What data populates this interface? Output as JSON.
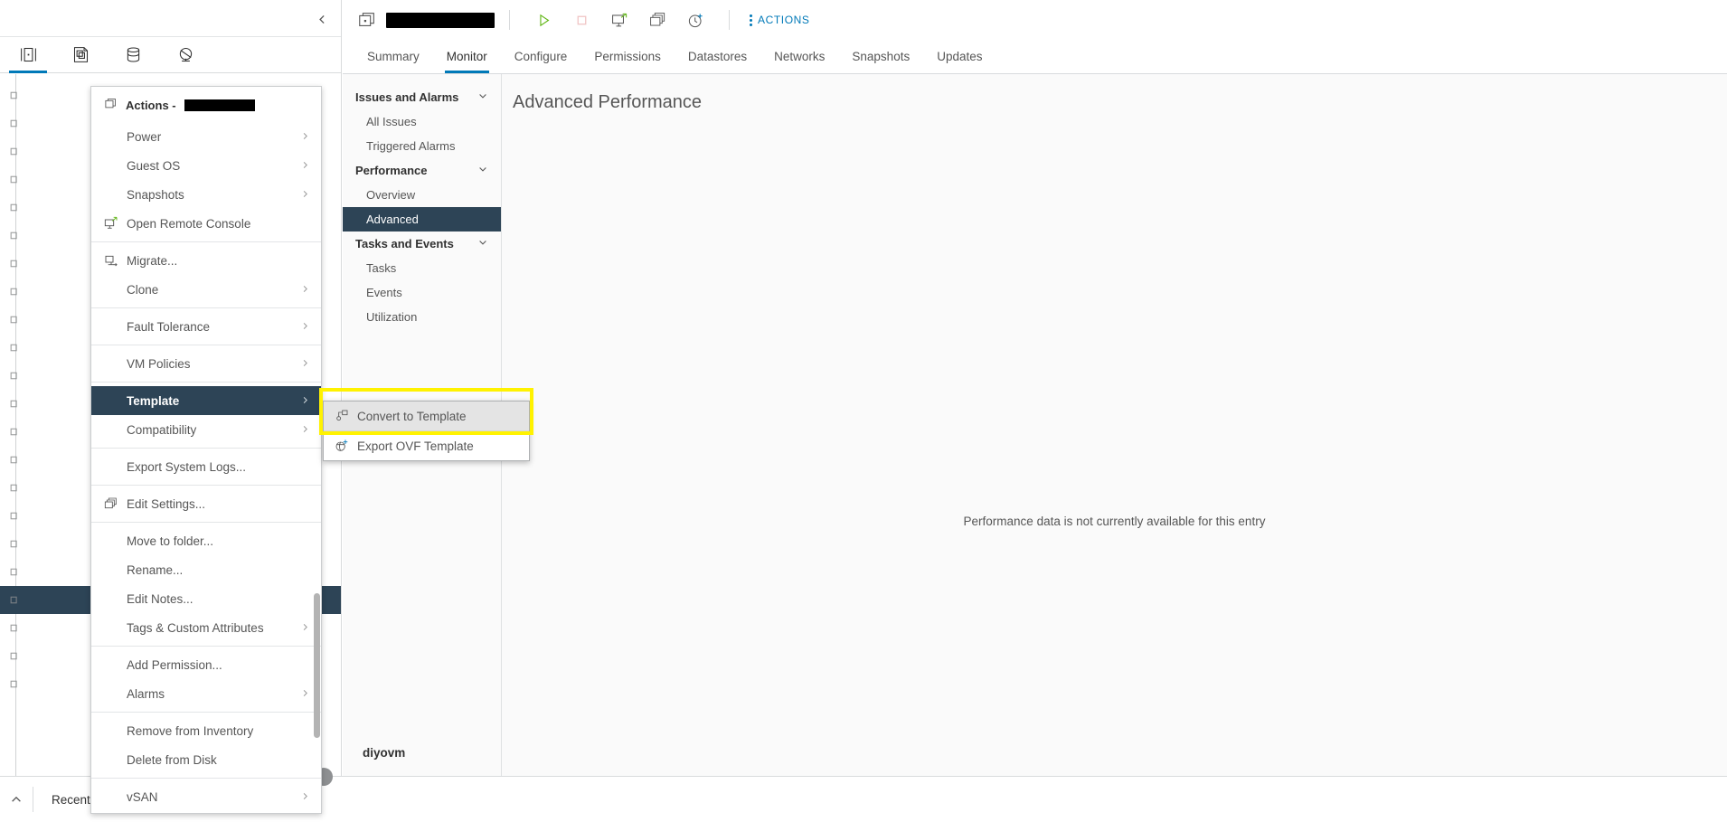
{
  "inventory": {
    "tabs": [
      {
        "name": "hosts-and-clusters",
        "icon": "host-icon",
        "active": true
      },
      {
        "name": "vms-and-templates",
        "icon": "vm-templates-icon",
        "active": false
      },
      {
        "name": "storage",
        "icon": "datastore-icon",
        "active": false
      },
      {
        "name": "networking",
        "icon": "network-icon",
        "active": false
      }
    ],
    "collapse_icon": "chevron-left-icon",
    "tree_rows": [
      {
        "label": ""
      },
      {
        "label": ""
      },
      {
        "label": ""
      },
      {
        "label": ""
      },
      {
        "label": ""
      },
      {
        "label": ""
      },
      {
        "label": ""
      },
      {
        "label": ""
      },
      {
        "label": ""
      },
      {
        "label": ""
      },
      {
        "label": ""
      },
      {
        "label": ""
      },
      {
        "label": ""
      },
      {
        "label": ""
      },
      {
        "label": ""
      },
      {
        "label": ""
      },
      {
        "label": ""
      },
      {
        "label": ""
      },
      {
        "label": ""
      },
      {
        "label": ""
      },
      {
        "label": ""
      },
      {
        "label": ""
      }
    ],
    "selected_row_index": 18
  },
  "vm_header": {
    "icon": "vm-icon",
    "name": "",
    "name_redacted": true,
    "buttons": [
      {
        "name": "power-on-button",
        "icon": "play-icon",
        "color": "#60b515"
      },
      {
        "name": "power-off-button",
        "icon": "stop-icon",
        "color": "#f5c2c2"
      },
      {
        "name": "launch-remote-console-button",
        "icon": "remote-console-icon",
        "color": "#565656"
      },
      {
        "name": "edit-settings-button",
        "icon": "settings-icon",
        "color": "#565656"
      },
      {
        "name": "take-snapshot-button",
        "icon": "snapshot-icon",
        "color": "#565656"
      }
    ],
    "actions_label": "ACTIONS",
    "actions_icon": "kebab-menu-icon"
  },
  "tabs": [
    {
      "label": "Summary",
      "active": false
    },
    {
      "label": "Monitor",
      "active": true
    },
    {
      "label": "Configure",
      "active": false
    },
    {
      "label": "Permissions",
      "active": false
    },
    {
      "label": "Datastores",
      "active": false
    },
    {
      "label": "Networks",
      "active": false
    },
    {
      "label": "Snapshots",
      "active": false
    },
    {
      "label": "Updates",
      "active": false
    }
  ],
  "monitor_nav": [
    {
      "type": "group",
      "label": "Issues and Alarms",
      "expanded": true,
      "icon": "chevron-down-icon"
    },
    {
      "type": "item",
      "label": "All Issues",
      "active": false
    },
    {
      "type": "item",
      "label": "Triggered Alarms",
      "active": false
    },
    {
      "type": "group",
      "label": "Performance",
      "expanded": true,
      "icon": "chevron-down-icon"
    },
    {
      "type": "item",
      "label": "Overview",
      "active": false
    },
    {
      "type": "item",
      "label": "Advanced",
      "active": true
    },
    {
      "type": "group",
      "label": "Tasks and Events",
      "expanded": true,
      "icon": "chevron-down-icon"
    },
    {
      "type": "item",
      "label": "Tasks",
      "active": false
    },
    {
      "type": "item",
      "label": "Events",
      "active": false
    },
    {
      "type": "item",
      "label": "Utilization",
      "active": false
    }
  ],
  "monitor_nav_footer": "diyovm",
  "main": {
    "title": "Advanced Performance",
    "empty_message": "Performance data is not currently available for this entry"
  },
  "context_menu": {
    "title_prefix": "Actions - ",
    "title_icon": "vm-icon",
    "title_target_redacted": true,
    "items": [
      {
        "label": "Power",
        "submenu": true,
        "icon": null
      },
      {
        "label": "Guest OS",
        "submenu": true,
        "icon": null
      },
      {
        "label": "Snapshots",
        "submenu": true,
        "icon": null
      },
      {
        "label": "Open Remote Console",
        "submenu": false,
        "icon": "remote-console-icon"
      },
      {
        "separator": true
      },
      {
        "label": "Migrate...",
        "submenu": false,
        "icon": "migrate-icon"
      },
      {
        "label": "Clone",
        "submenu": true,
        "icon": null
      },
      {
        "separator": true
      },
      {
        "label": "Fault Tolerance",
        "submenu": true,
        "icon": null
      },
      {
        "separator": true
      },
      {
        "label": "VM Policies",
        "submenu": true,
        "icon": null
      },
      {
        "separator": true
      },
      {
        "label": "Template",
        "submenu": true,
        "icon": null,
        "selected": true
      },
      {
        "label": "Compatibility",
        "submenu": true,
        "icon": null
      },
      {
        "separator": true
      },
      {
        "label": "Export System Logs...",
        "submenu": false,
        "icon": null
      },
      {
        "separator": true
      },
      {
        "label": "Edit Settings...",
        "submenu": false,
        "icon": "settings-icon"
      },
      {
        "separator": true
      },
      {
        "label": "Move to folder...",
        "submenu": false,
        "icon": null
      },
      {
        "label": "Rename...",
        "submenu": false,
        "icon": null
      },
      {
        "label": "Edit Notes...",
        "submenu": false,
        "icon": null
      },
      {
        "label": "Tags & Custom Attributes",
        "submenu": true,
        "icon": null
      },
      {
        "separator": true
      },
      {
        "label": "Add Permission...",
        "submenu": false,
        "icon": null
      },
      {
        "label": "Alarms",
        "submenu": true,
        "icon": null
      },
      {
        "separator": true
      },
      {
        "label": "Remove from Inventory",
        "submenu": false,
        "icon": null
      },
      {
        "label": "Delete from Disk",
        "submenu": false,
        "icon": null
      },
      {
        "separator": true
      },
      {
        "label": "vSAN",
        "submenu": true,
        "icon": null
      }
    ]
  },
  "submenu": {
    "items": [
      {
        "label": "Convert to Template",
        "icon": "convert-to-template-icon",
        "hovered": true
      },
      {
        "label": "Export OVF Template",
        "icon": "export-ovf-icon",
        "hovered": false
      }
    ],
    "highlight_color": "#FFF200"
  },
  "bottom_bar": {
    "chevron_icon": "chevron-up-icon",
    "recent_tasks_label": "Recent"
  },
  "colors": {
    "accent": "#0079b8",
    "selection": "#2d4456",
    "highlight": "#FFF200",
    "power_on_green": "#60b515"
  }
}
